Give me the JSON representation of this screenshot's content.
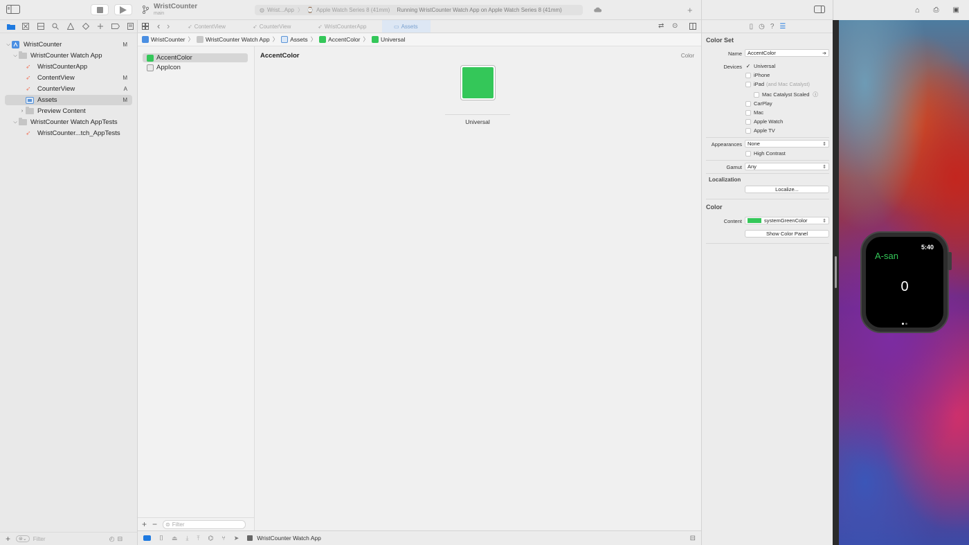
{
  "toolbar": {
    "project_title": "WristCounter",
    "branch": "main",
    "scheme": "Wrist...App",
    "device": "Apple Watch Series 8 (41mm)",
    "status": "Running WristCounter Watch App on Apple Watch Series 8 (41mm)"
  },
  "navigator": {
    "items": [
      {
        "label": "WristCounter",
        "badge": "M"
      },
      {
        "label": "WristCounter Watch App",
        "badge": ""
      },
      {
        "label": "WristCounterApp",
        "badge": ""
      },
      {
        "label": "ContentView",
        "badge": "M"
      },
      {
        "label": "CounterView",
        "badge": "A"
      },
      {
        "label": "Assets",
        "badge": "M"
      },
      {
        "label": "Preview Content",
        "badge": ""
      },
      {
        "label": "WristCounter Watch AppTests",
        "badge": ""
      },
      {
        "label": "WristCounter...tch_AppTests",
        "badge": ""
      }
    ],
    "filter_placeholder": "Filter"
  },
  "editor_tabs": [
    {
      "label": "ContentView"
    },
    {
      "label": "CounterView"
    },
    {
      "label": "WristCounterApp"
    },
    {
      "label": "Assets"
    }
  ],
  "jumpbar": {
    "items": [
      "WristCounter",
      "WristCounter Watch App",
      "Assets",
      "AccentColor",
      "Universal"
    ]
  },
  "assets": {
    "items": [
      {
        "label": "AccentColor"
      },
      {
        "label": "AppIcon"
      }
    ],
    "filter_placeholder": "Filter"
  },
  "canvas": {
    "title": "AccentColor",
    "kind": "Color",
    "well_label": "Universal"
  },
  "debug": {
    "target": "WristCounter Watch App"
  },
  "inspector": {
    "color_set_heading": "Color Set",
    "name_label": "Name",
    "name_value": "AccentColor",
    "devices_label": "Devices",
    "devices": [
      {
        "label": "Universal",
        "checked": true,
        "note": ""
      },
      {
        "label": "iPhone",
        "checked": false,
        "note": ""
      },
      {
        "label": "iPad",
        "checked": false,
        "note": "(and Mac Catalyst)"
      },
      {
        "label": "Mac Catalyst Scaled",
        "checked": false,
        "note": ""
      },
      {
        "label": "CarPlay",
        "checked": false,
        "note": ""
      },
      {
        "label": "Mac",
        "checked": false,
        "note": ""
      },
      {
        "label": "Apple Watch",
        "checked": false,
        "note": ""
      },
      {
        "label": "Apple TV",
        "checked": false,
        "note": ""
      }
    ],
    "appearances_label": "Appearances",
    "appearances_value": "None",
    "high_contrast": "High Contrast",
    "gamut_label": "Gamut",
    "gamut_value": "Any",
    "localization_heading": "Localization",
    "localize_button": "Localize...",
    "color_heading": "Color",
    "content_label": "Content",
    "content_value": "systemGreenColor",
    "show_color_panel": "Show Color Panel"
  },
  "watch": {
    "title": "A-san",
    "time": "5:40",
    "count": "0"
  },
  "colors": {
    "accent": "#34c759",
    "selection_tab": "#dde7f4",
    "xcode_blue": "#1f7ae0"
  }
}
